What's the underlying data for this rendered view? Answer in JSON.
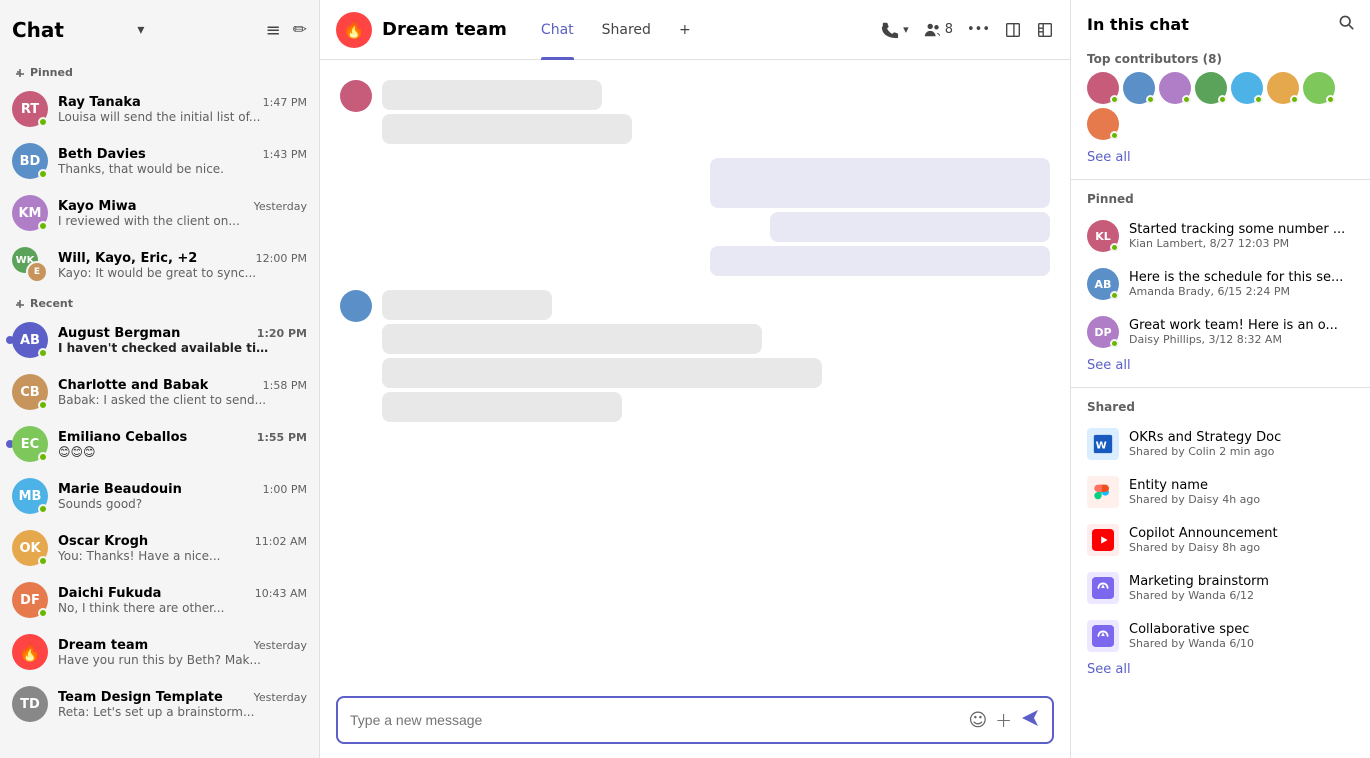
{
  "app": {
    "title": "Chat",
    "title_chevron": "▾",
    "filter_icon": "≡",
    "compose_icon": "✏"
  },
  "sidebar": {
    "pinned_label": "Pinned",
    "recent_label": "Recent",
    "pinned_items": [
      {
        "id": 1,
        "name": "Ray Tanaka",
        "time": "1:47 PM",
        "preview": "Louisa will send the initial list of...",
        "color": "#c75b7a",
        "initials": "RT",
        "unread": false
      },
      {
        "id": 2,
        "name": "Beth Davies",
        "time": "1:43 PM",
        "preview": "Thanks, that would be nice.",
        "color": "#5b8fc7",
        "initials": "BD",
        "unread": false
      },
      {
        "id": 3,
        "name": "Kayo Miwa",
        "time": "Yesterday",
        "preview": "I reviewed with the client on...",
        "color": "#b07dc7",
        "initials": "KM",
        "unread": false
      },
      {
        "id": 4,
        "name": "Will, Kayo, Eric, +2",
        "time": "12:00 PM",
        "preview": "Kayo: It would be great to sync...",
        "color": "#5ba35b",
        "initials": "WK",
        "unread": false
      }
    ],
    "recent_items": [
      {
        "id": 5,
        "name": "August Bergman",
        "time": "1:20 PM",
        "preview": "I haven't checked available time...",
        "color": "#5b5fc7",
        "initials": "AB",
        "unread": true
      },
      {
        "id": 6,
        "name": "Charlotte and Babak",
        "time": "1:58 PM",
        "preview": "Babak: I asked the client to send...",
        "color": "#c7955b",
        "initials": "CB",
        "unread": false
      },
      {
        "id": 7,
        "name": "Emiliano Ceballos",
        "time": "1:55 PM",
        "preview": "😊😊😊",
        "color": "#7dc75b",
        "initials": "EC",
        "unread": true
      },
      {
        "id": 8,
        "name": "Marie Beaudouin",
        "time": "1:00 PM",
        "preview": "Sounds good?",
        "color": "#4db3e6",
        "initials": "MB",
        "unread": false
      },
      {
        "id": 9,
        "name": "Oscar Krogh",
        "time": "11:02 AM",
        "preview": "You: Thanks! Have a nice...",
        "color": "#e6a84d",
        "initials": "OK",
        "unread": false
      },
      {
        "id": 10,
        "name": "Daichi Fukuda",
        "time": "10:43 AM",
        "preview": "No, I think there are other...",
        "color": "#e67a4d",
        "initials": "DF",
        "unread": false
      },
      {
        "id": 11,
        "name": "Dream team",
        "time": "Yesterday",
        "preview": "Have you run this by Beth? Mak...",
        "color": "#ff4444",
        "initials": "🔥",
        "unread": false,
        "is_group": true
      },
      {
        "id": 12,
        "name": "Team Design Template",
        "time": "Yesterday",
        "preview": "Reta: Let's set up a brainstorm...",
        "color": "#888",
        "initials": "TD",
        "unread": false
      }
    ]
  },
  "main_header": {
    "group_emoji": "🔥",
    "title": "Dream team",
    "tabs": [
      {
        "label": "Chat",
        "active": true
      },
      {
        "label": "Shared",
        "active": false
      }
    ],
    "add_tab": "+",
    "actions": {
      "call_label": "",
      "participants_count": "8",
      "more_label": "•••"
    }
  },
  "chat_messages": {
    "incoming_1": {
      "bubble1_width": 220,
      "bubble2_width": 250
    },
    "outgoing_1": {
      "bubble1_width": 340,
      "bubble2_width": 280,
      "bubble3_width": 340
    },
    "incoming_2": {
      "bubble1_width": 170,
      "bubble2_width": 380,
      "bubble3_width": 440,
      "bubble4_width": 240
    }
  },
  "chat_input": {
    "placeholder": "Type a new message"
  },
  "right_panel": {
    "title": "In this chat",
    "contributors_label": "Top contributors (8)",
    "see_all_label": "See all",
    "pinned_label": "Pinned",
    "shared_label": "Shared",
    "pinned_items": [
      {
        "text": "Started tracking some number ...",
        "meta": "Kian Lambert, 8/27 12:03 PM",
        "color": "#c75b7a",
        "initials": "KL"
      },
      {
        "text": "Here is the schedule for this se...",
        "meta": "Amanda Brady, 6/15 2:24 PM",
        "color": "#5b8fc7",
        "initials": "AB"
      },
      {
        "text": "Great work team! Here is an o...",
        "meta": "Daisy Phillips, 3/12 8:32 AM",
        "color": "#b07dc7",
        "initials": "DP"
      }
    ],
    "pinned_see_all": "See all",
    "shared_items": [
      {
        "name": "OKRs and Strategy Doc",
        "meta": "Shared by Colin 2 min ago",
        "type": "word",
        "color": "#185abd"
      },
      {
        "name": "Entity name",
        "meta": "Shared by Daisy 4h ago",
        "type": "figma",
        "color": "#f24e1e"
      },
      {
        "name": "Copilot Announcement",
        "meta": "Shared by Daisy 8h ago",
        "type": "youtube",
        "color": "#ff0000"
      },
      {
        "name": "Marketing brainstorm",
        "meta": "Shared by Wanda 6/12",
        "type": "loop",
        "color": "#7b68ee"
      },
      {
        "name": "Collaborative spec",
        "meta": "Shared by Wanda 6/10",
        "type": "loop",
        "color": "#7b68ee"
      }
    ],
    "shared_see_all": "See all"
  }
}
